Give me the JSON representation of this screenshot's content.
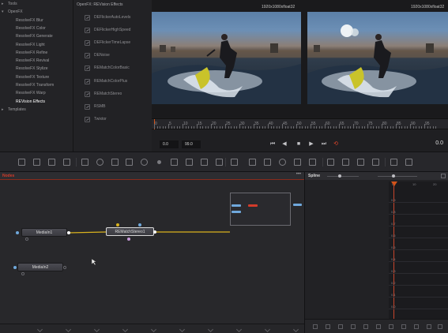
{
  "library": {
    "tree": [
      {
        "label": "Tools",
        "indent": false,
        "expanded": false,
        "selected": false
      },
      {
        "label": "OpenFX",
        "indent": false,
        "expanded": true,
        "selected": false
      },
      {
        "label": "ResolveFX Blur",
        "indent": true,
        "selected": false
      },
      {
        "label": "ResolveFX Color",
        "indent": true,
        "selected": false
      },
      {
        "label": "ResolveFX Generate",
        "indent": true,
        "selected": false
      },
      {
        "label": "ResolveFX Light",
        "indent": true,
        "selected": false
      },
      {
        "label": "ResolveFX Refine",
        "indent": true,
        "selected": false
      },
      {
        "label": "ResolveFX Revival",
        "indent": true,
        "selected": false
      },
      {
        "label": "ResolveFX Stylize",
        "indent": true,
        "selected": false
      },
      {
        "label": "ResolveFX Texture",
        "indent": true,
        "selected": false
      },
      {
        "label": "ResolveFX Transform",
        "indent": true,
        "selected": false
      },
      {
        "label": "ResolveFX Warp",
        "indent": true,
        "selected": false
      },
      {
        "label": "REVision Effects",
        "indent": true,
        "selected": true
      },
      {
        "label": "Templates",
        "indent": false,
        "expanded": false,
        "selected": false
      }
    ]
  },
  "effects": {
    "header": "OpenFX: REVision Effects",
    "items": [
      "DEFlickerAutoLevels",
      "DEFlickerHighSpeed",
      "DEFlickerTimeLapse",
      "DENoise",
      "REMatchColorBasic",
      "REMatchColorPlus",
      "REMatchStereo",
      "RSMB",
      "Twixtor"
    ]
  },
  "viewers": {
    "left_label": "1920x1080xfloat32",
    "right_label": "1920x1080xfloat32"
  },
  "ruler": {
    "labels": [
      "0",
      "5",
      "10",
      "15",
      "20",
      "25",
      "30",
      "35",
      "40",
      "45",
      "50",
      "55",
      "60",
      "65",
      "70",
      "75",
      "80",
      "85",
      "90",
      "95"
    ]
  },
  "transport": {
    "start": "0.0",
    "end": "99.0",
    "current_frame": "0.0",
    "buttons": [
      {
        "name": "skip-to-start-icon",
        "glyph": "⏮"
      },
      {
        "name": "play-reverse-icon",
        "glyph": "◀"
      },
      {
        "name": "stop-icon",
        "glyph": "■"
      },
      {
        "name": "play-icon",
        "glyph": "▶"
      },
      {
        "name": "skip-to-end-icon",
        "glyph": "⏭"
      },
      {
        "name": "loop-icon",
        "glyph": "⟲"
      }
    ]
  },
  "toolbar": {
    "tools": [
      {
        "name": "background-tool-icon",
        "shape": "square"
      },
      {
        "name": "paint-tool-icon",
        "shape": "square"
      },
      {
        "name": "text-tool-icon",
        "shape": "square"
      },
      {
        "name": "brush-tool-icon",
        "shape": "square"
      },
      {
        "name": "merge-tool-icon",
        "shape": "square"
      },
      {
        "name": "mask-tool-icon",
        "shape": "round"
      },
      {
        "name": "polygon-tool-icon",
        "shape": "square"
      },
      {
        "name": "bspline-tool-icon",
        "shape": "square"
      },
      {
        "name": "particle-tool-icon",
        "shape": "round"
      },
      {
        "name": "blur-tool-icon",
        "shape": "dot"
      },
      {
        "name": "color-corrector-icon",
        "shape": "square"
      },
      {
        "name": "curves-tool-icon",
        "shape": "square"
      },
      {
        "name": "transform-tool-icon",
        "shape": "square"
      },
      {
        "name": "channel-booleans-icon",
        "shape": "square"
      },
      {
        "name": "matte-control-icon",
        "shape": "square"
      },
      {
        "name": "tracker-tool-icon",
        "shape": "square"
      },
      {
        "name": "rectangle-mask-icon",
        "shape": "square"
      },
      {
        "name": "ellipse-mask-icon",
        "shape": "round"
      },
      {
        "name": "polygon-mask-icon",
        "shape": "square"
      },
      {
        "name": "bspline-mask-icon",
        "shape": "square"
      },
      {
        "name": "shape-3d-icon",
        "shape": "square"
      },
      {
        "name": "camera-3d-icon",
        "shape": "square"
      },
      {
        "name": "merge-3d-icon",
        "shape": "square"
      },
      {
        "name": "renderer-3d-icon",
        "shape": "square"
      },
      {
        "name": "lock-icon",
        "shape": "square"
      },
      {
        "name": "grid-icon",
        "shape": "square"
      }
    ]
  },
  "nodes": {
    "title": "Nodes",
    "more": "•••",
    "items": [
      {
        "label": "MediaIn1",
        "selected": false
      },
      {
        "label": "REMatchStereo1",
        "selected": true
      },
      {
        "label": "MediaIn2",
        "selected": false
      }
    ]
  },
  "spline": {
    "title": "Spline",
    "x_labels": [
      "0",
      "10",
      "20"
    ],
    "y_labels": [
      "0.9",
      "0.8",
      "0.7",
      "0.6",
      "0.5",
      "0.4",
      "0.3",
      "0.2",
      "0.1",
      "0.0"
    ]
  },
  "colors": {
    "accent_red": "#d23b2a",
    "node_link_yellow": "#d9b21e",
    "port_blue": "#6fa8dc",
    "playhead": "#d2531a"
  }
}
